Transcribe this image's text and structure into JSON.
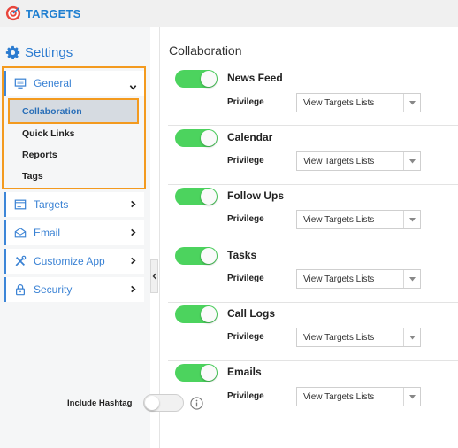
{
  "app": {
    "title": "TARGETS"
  },
  "sidebar": {
    "heading": "Settings",
    "items": [
      {
        "label": "General",
        "icon": "monitor-icon",
        "expanded": true,
        "children": [
          {
            "label": "Collaboration",
            "active": true
          },
          {
            "label": "Quick Links"
          },
          {
            "label": "Reports"
          },
          {
            "label": "Tags"
          }
        ]
      },
      {
        "label": "Targets",
        "icon": "list-card-icon"
      },
      {
        "label": "Email",
        "icon": "envelope-icon"
      },
      {
        "label": "Customize App",
        "icon": "tools-icon"
      },
      {
        "label": "Security",
        "icon": "lock-icon"
      }
    ]
  },
  "main": {
    "title": "Collaboration",
    "privilege_label": "Privilege",
    "sections": [
      {
        "title": "News Feed",
        "enabled": true,
        "privilege": "View Targets Lists"
      },
      {
        "title": "Calendar",
        "enabled": true,
        "privilege": "View Targets Lists"
      },
      {
        "title": "Follow Ups",
        "enabled": true,
        "privilege": "View Targets Lists"
      },
      {
        "title": "Tasks",
        "enabled": true,
        "privilege": "View Targets Lists"
      },
      {
        "title": "Call Logs",
        "enabled": true,
        "privilege": "View Targets Lists"
      },
      {
        "title": "Emails",
        "enabled": true,
        "privilege": "View Targets Lists"
      }
    ],
    "include_hashtag": {
      "label": "Include Hashtag",
      "enabled": false
    }
  },
  "colors": {
    "accent": "#3a82d4",
    "toggle_on": "#4cd35e",
    "highlight": "#f39a1f"
  }
}
